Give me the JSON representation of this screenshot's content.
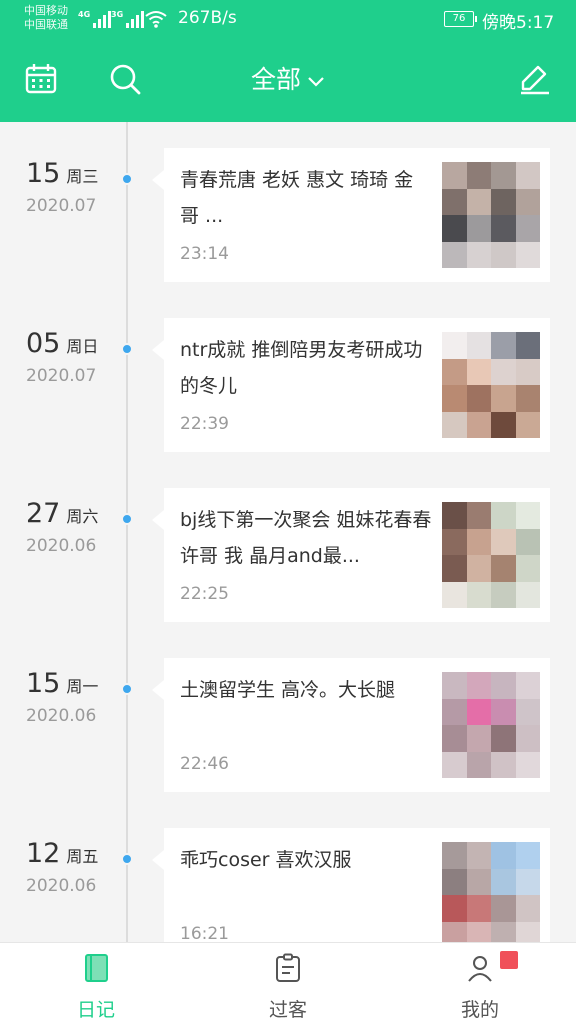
{
  "status_bar": {
    "carrier_1": "中国移动",
    "carrier_2": "中国联通",
    "net_1": "4G",
    "net_2": "3G",
    "speed": "267B/s",
    "battery": "76",
    "time": "傍晚5:17"
  },
  "toolbar": {
    "filter_label": "全部",
    "icons": [
      "calendar-icon",
      "search-icon",
      "chevron-down-icon",
      "edit-icon"
    ]
  },
  "entries": [
    {
      "day": "15",
      "weekday": "周三",
      "year_month": "2020.07",
      "title": "青春荒唐 老妖 惠文 琦琦 金哥 ...",
      "time": "23:14"
    },
    {
      "day": "05",
      "weekday": "周日",
      "year_month": "2020.07",
      "title": "ntr成就 推倒陪男友考研成功的冬儿",
      "time": "22:39"
    },
    {
      "day": "27",
      "weekday": "周六",
      "year_month": "2020.06",
      "title": "bj线下第一次聚会 姐妹花春春 许哥 我 晶月and最...",
      "time": "22:25"
    },
    {
      "day": "15",
      "weekday": "周一",
      "year_month": "2020.06",
      "title": "土澳留学生 高冷。大长腿",
      "time": "22:46"
    },
    {
      "day": "12",
      "weekday": "周五",
      "year_month": "2020.06",
      "title": "乖巧coser 喜欢汉服",
      "time": "16:21"
    }
  ],
  "bottom_nav": [
    {
      "label": "日记",
      "icon": "diary-book-icon",
      "active": true
    },
    {
      "label": "过客",
      "icon": "clipboard-icon",
      "active": false
    },
    {
      "label": "我的",
      "icon": "profile-icon",
      "active": false
    }
  ],
  "colors": {
    "accent": "#1fcf8c",
    "timeline_dot": "#3ea7ee",
    "badge": "#f0505a",
    "background": "#f4f4f4"
  }
}
